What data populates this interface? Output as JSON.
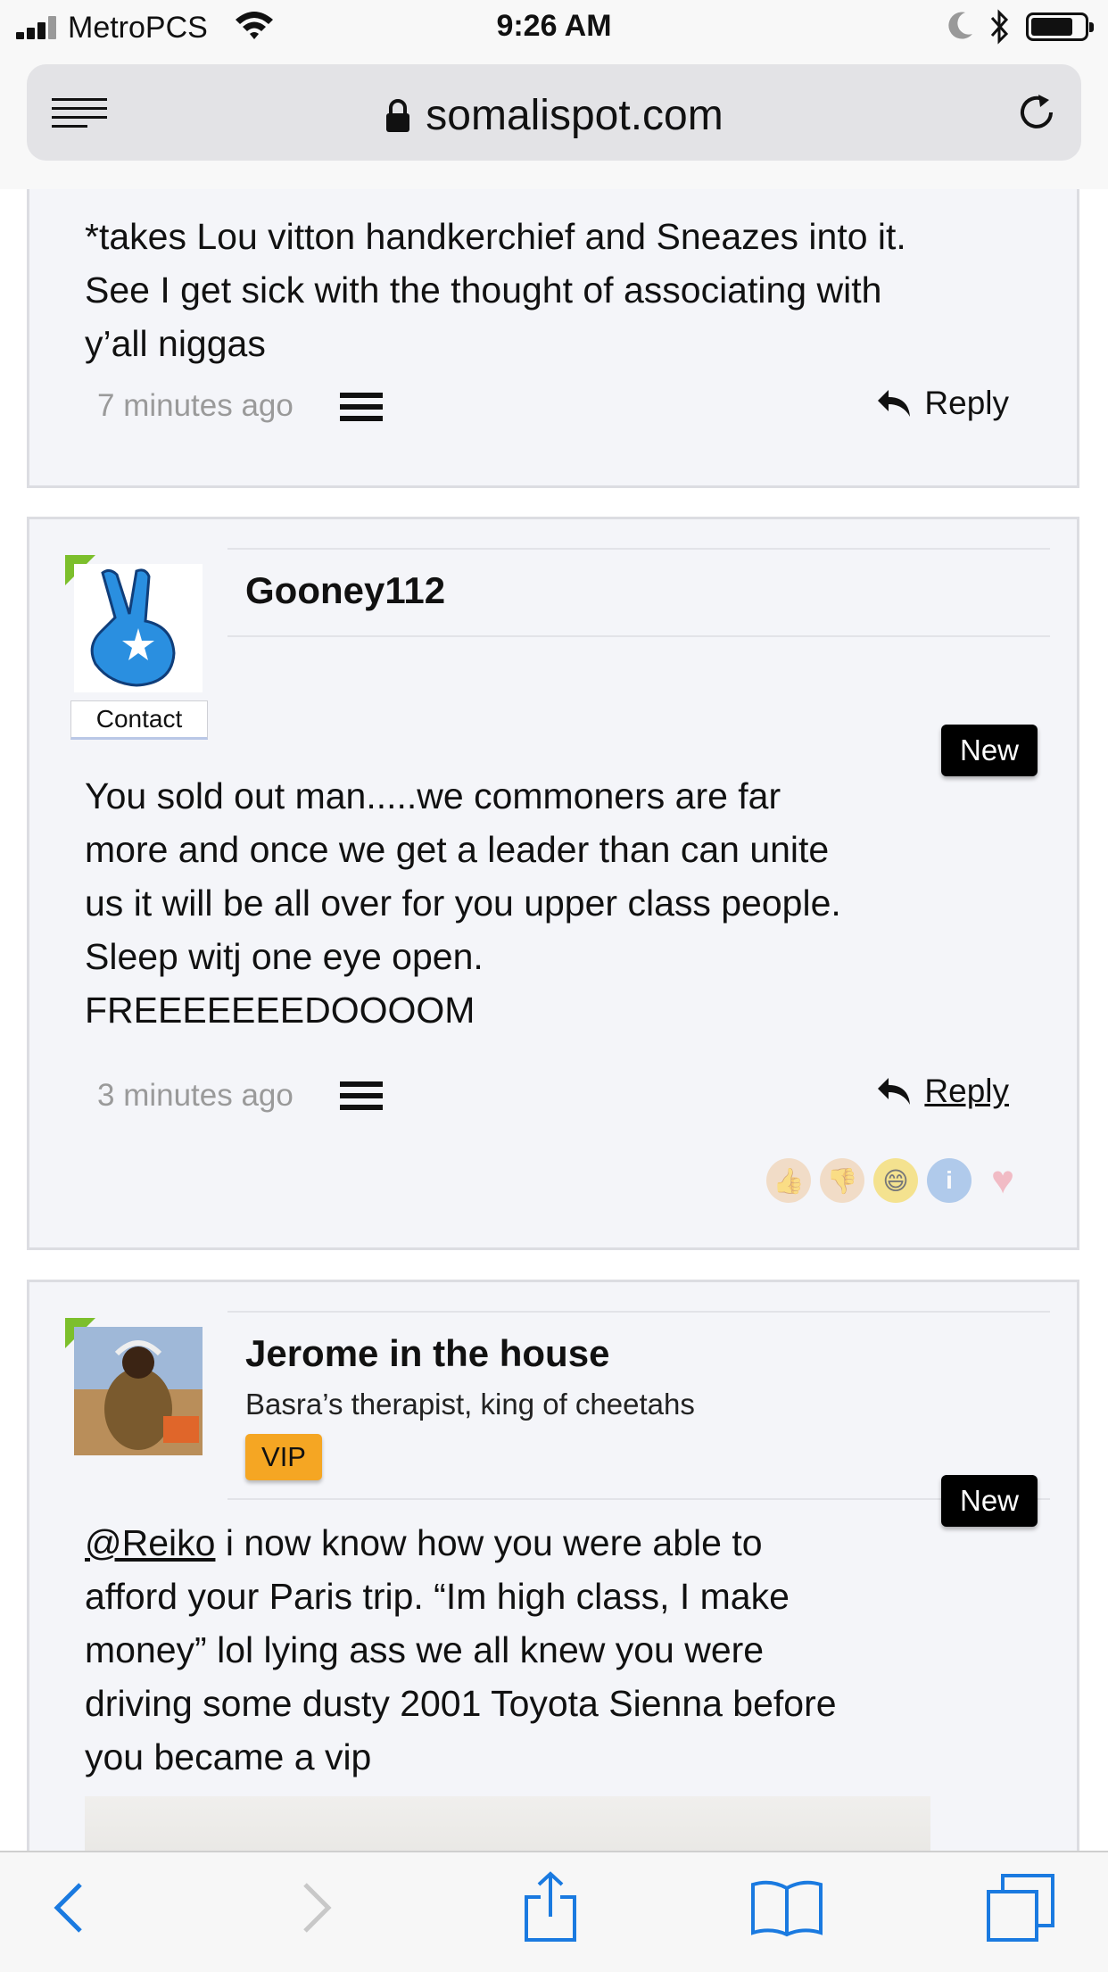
{
  "status_bar": {
    "carrier": "MetroPCS",
    "time": "9:26 AM"
  },
  "browser": {
    "url": "somalispot.com"
  },
  "posts": [
    {
      "text_lines": [
        "*takes Lou vitton handkerchief and Sneazes into it.",
        "See I get sick with the thought of associating with",
        "y’all niggas"
      ],
      "time": "7 minutes ago",
      "reply_label": "Reply"
    },
    {
      "username": "Gooney112",
      "contact_label": "Contact",
      "badge": "New",
      "text_lines": [
        "You sold out man.....we commoners are far",
        "more and once we get a leader than can unite",
        "us it will be all over for you upper class people.",
        "Sleep witj one eye open.",
        "FREEEEEEEDOOOOM"
      ],
      "time": "3 minutes ago",
      "reply_label": "Reply",
      "reactions": [
        "thumbs-up-icon",
        "thumbs-down-icon",
        "laugh-icon",
        "info-icon",
        "heart-icon"
      ]
    },
    {
      "username": "Jerome in the house",
      "user_title": "Basra’s therapist, king of cheetahs",
      "rank": "VIP",
      "badge": "New",
      "mention": "@Reiko",
      "text_first_rest": " i now know how you were able to",
      "text_lines": [
        "afford your Paris trip. “Im high class, I make",
        "money” lol lying ass we all knew you were",
        "driving some dusty 2001 Toyota Sienna before",
        "you became a vip"
      ]
    }
  ],
  "colors": {
    "accent_blue": "#1a7ae0",
    "vip_orange": "#f5a623",
    "new_badge": "#000000",
    "post_bg": "#f4f5f9"
  }
}
